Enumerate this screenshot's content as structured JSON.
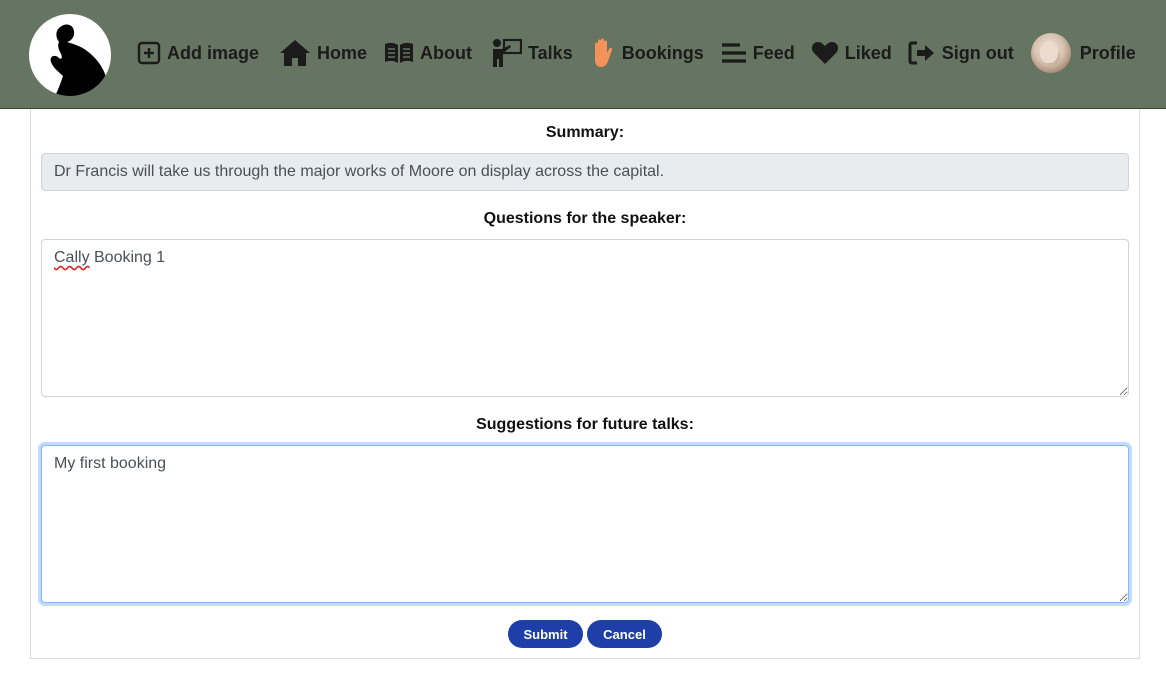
{
  "nav": {
    "logo_alt": "thinker-logo",
    "items": [
      {
        "label": "Add image",
        "icon": "plus-square-icon"
      },
      {
        "label": "Home",
        "icon": "home-icon"
      },
      {
        "label": "About",
        "icon": "book-open-icon"
      },
      {
        "label": "Talks",
        "icon": "presenter-icon"
      },
      {
        "label": "Bookings",
        "icon": "hand-icon"
      },
      {
        "label": "Feed",
        "icon": "bars-icon"
      },
      {
        "label": "Liked",
        "icon": "heart-icon"
      },
      {
        "label": "Sign out",
        "icon": "sign-out-icon"
      },
      {
        "label": "Profile",
        "icon": "avatar"
      }
    ],
    "accent_bookings": "#f4925b",
    "background": "#667561"
  },
  "form": {
    "summary_label": "Summary:",
    "summary_value": "Dr Francis will take us through the major works of Moore on display across the capital.",
    "questions_label": "Questions for the speaker:",
    "questions_word1": "Cally",
    "questions_rest": " Booking 1",
    "suggestions_label": "Suggestions for future talks:",
    "suggestions_value": "My first booking",
    "submit_label": "Submit",
    "cancel_label": "Cancel",
    "button_color": "#1f3fa8"
  }
}
